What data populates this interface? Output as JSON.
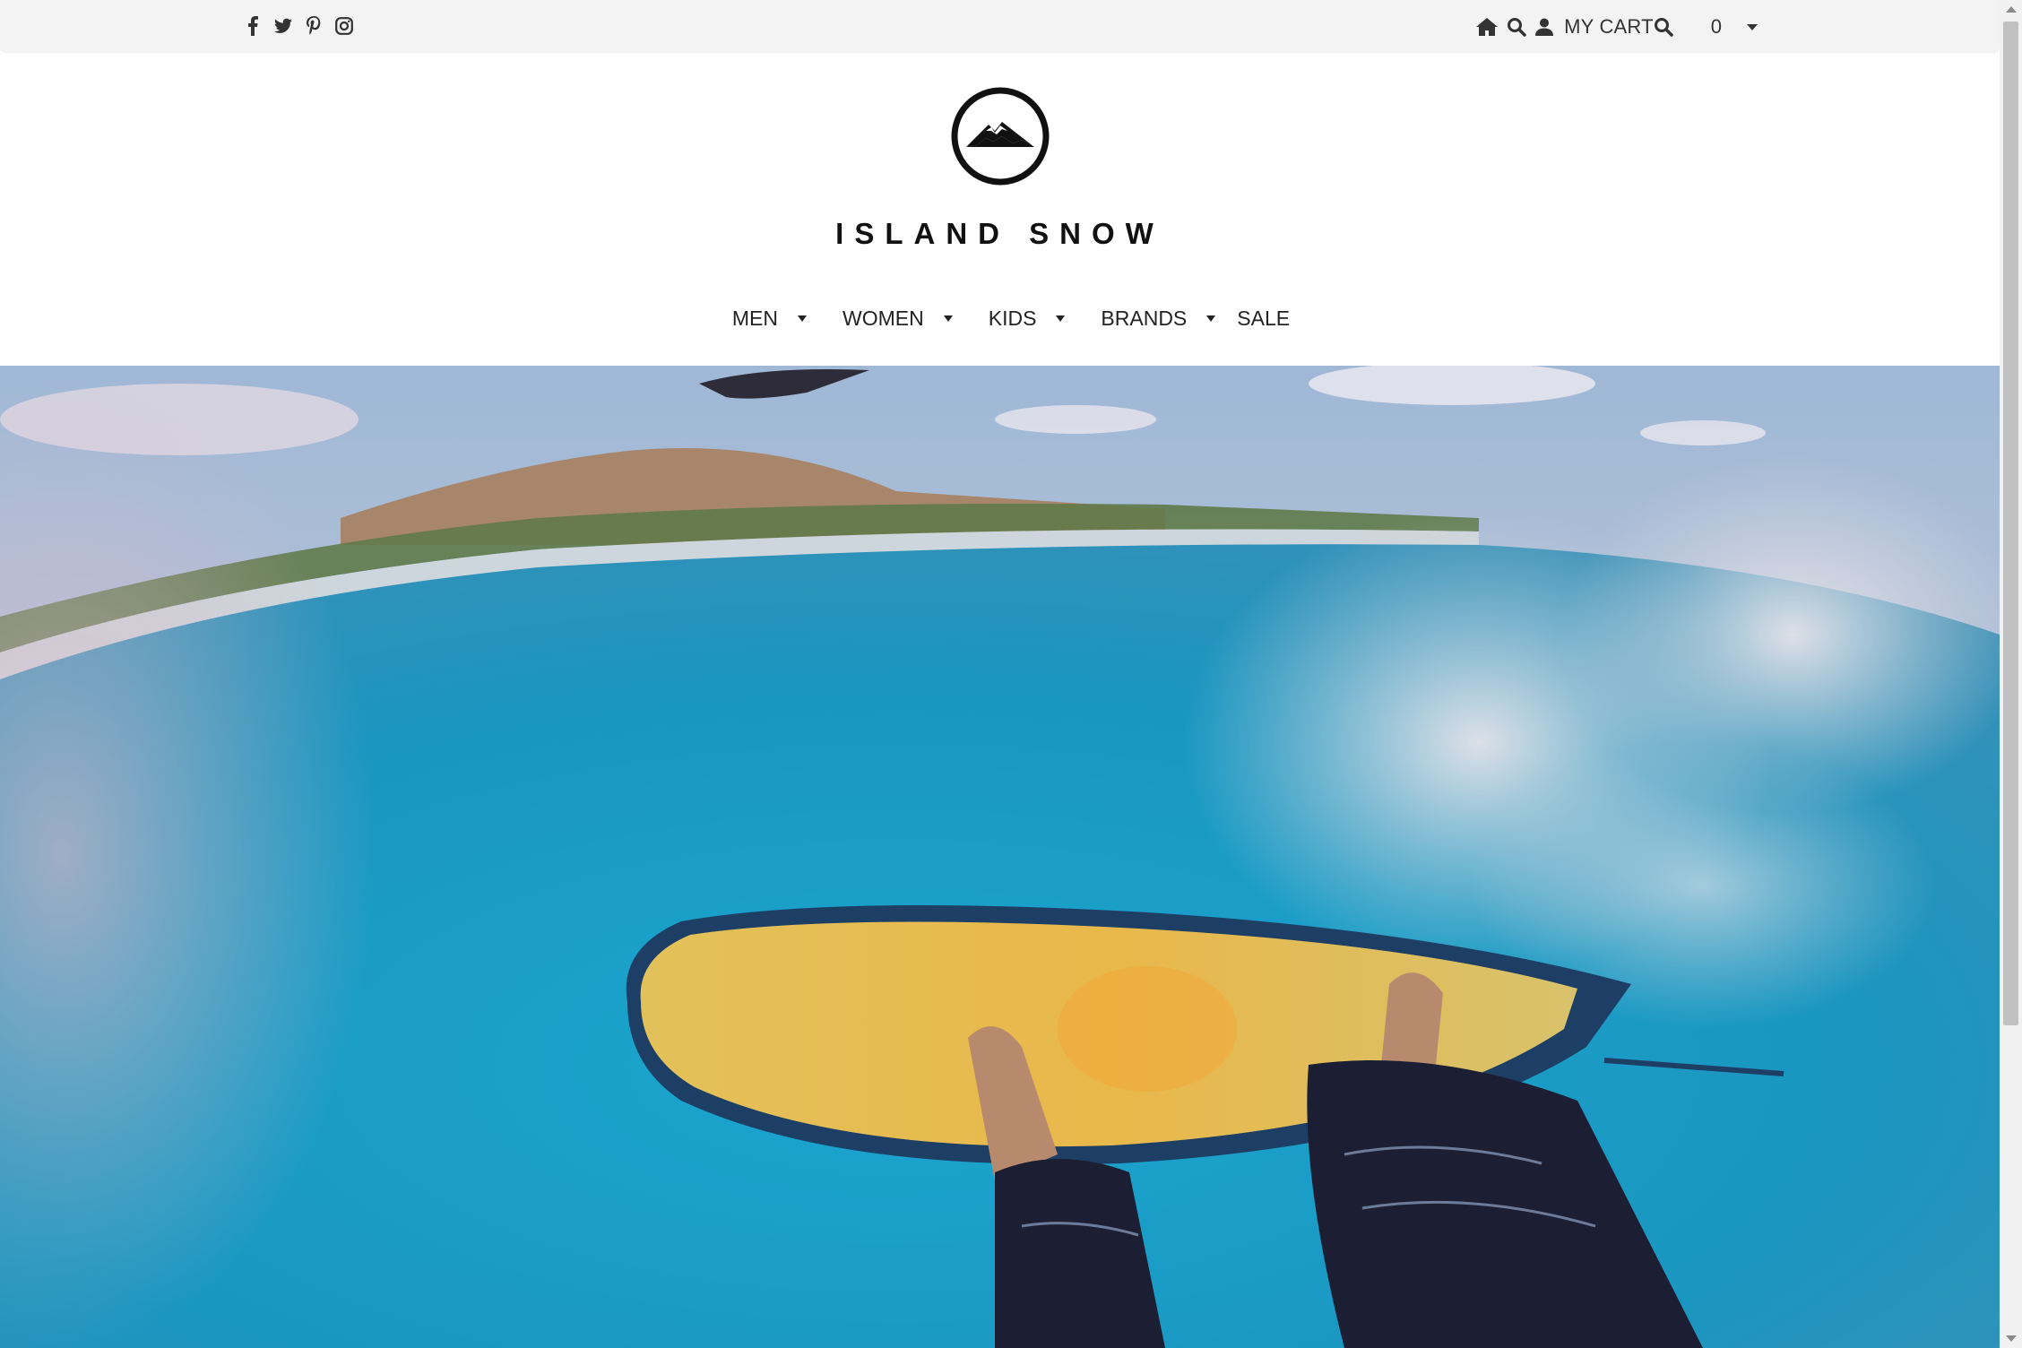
{
  "topbar": {
    "social_icons": [
      "facebook-icon",
      "twitter-icon",
      "pinterest-icon",
      "instagram-icon"
    ],
    "home_icon": "home-icon",
    "search_icon": "search-icon",
    "account_icon": "user-icon",
    "cart_label": "MY CART",
    "cart_search_icon": "search-icon",
    "cart_count": "0"
  },
  "brand": {
    "name": "ISLAND SNOW",
    "logo_icon": "mountain-logo-icon"
  },
  "nav": {
    "items": [
      {
        "label": "MEN",
        "has_dropdown": true
      },
      {
        "label": "WOMEN",
        "has_dropdown": true
      },
      {
        "label": "KIDS",
        "has_dropdown": true
      },
      {
        "label": "BRANDS",
        "has_dropdown": true
      },
      {
        "label": "SALE",
        "has_dropdown": false
      }
    ]
  },
  "hero": {
    "image": "surfer-on-wave-hero-image"
  },
  "colors": {
    "topbar_bg": "#f3f3f3",
    "text": "#222222",
    "water": "#1f9fc4",
    "sky": "#b8cde3"
  }
}
